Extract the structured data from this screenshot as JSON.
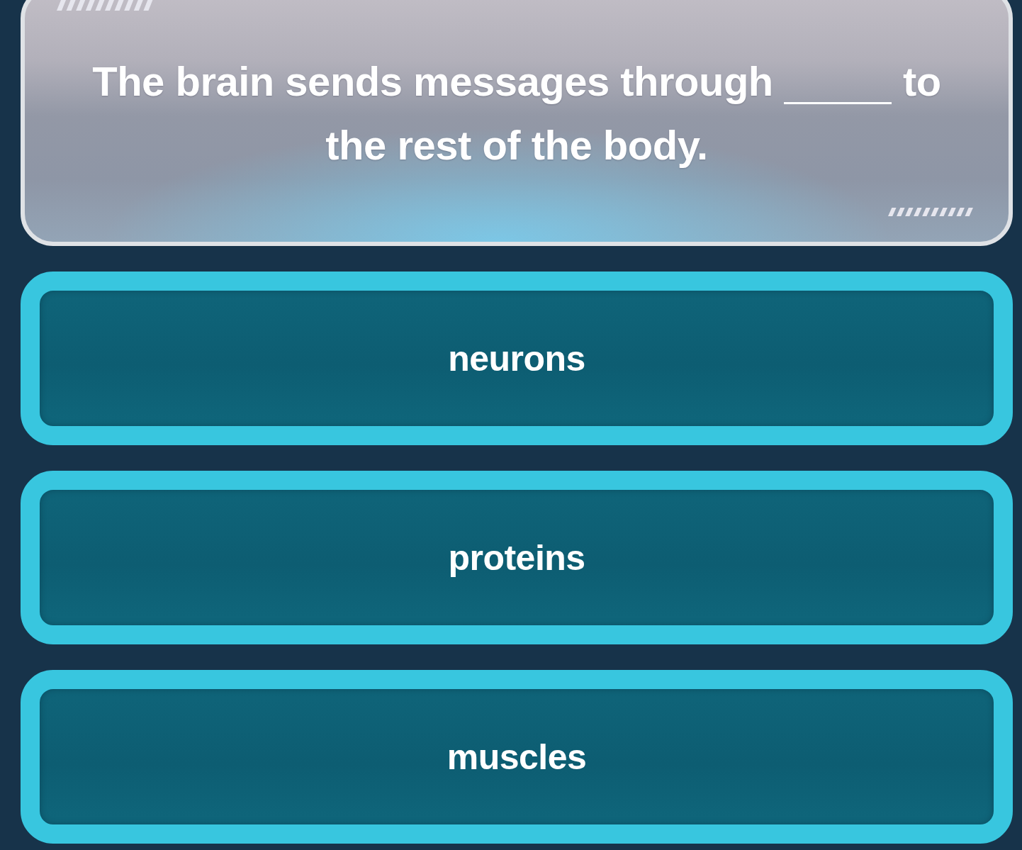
{
  "question": {
    "text_before": "The brain sends messages through",
    "text_after": "to the rest of the body."
  },
  "answers": [
    {
      "label": "neurons",
      "selected": false
    },
    {
      "label": "proteins",
      "selected": false
    },
    {
      "label": "muscles",
      "selected": false
    }
  ]
}
